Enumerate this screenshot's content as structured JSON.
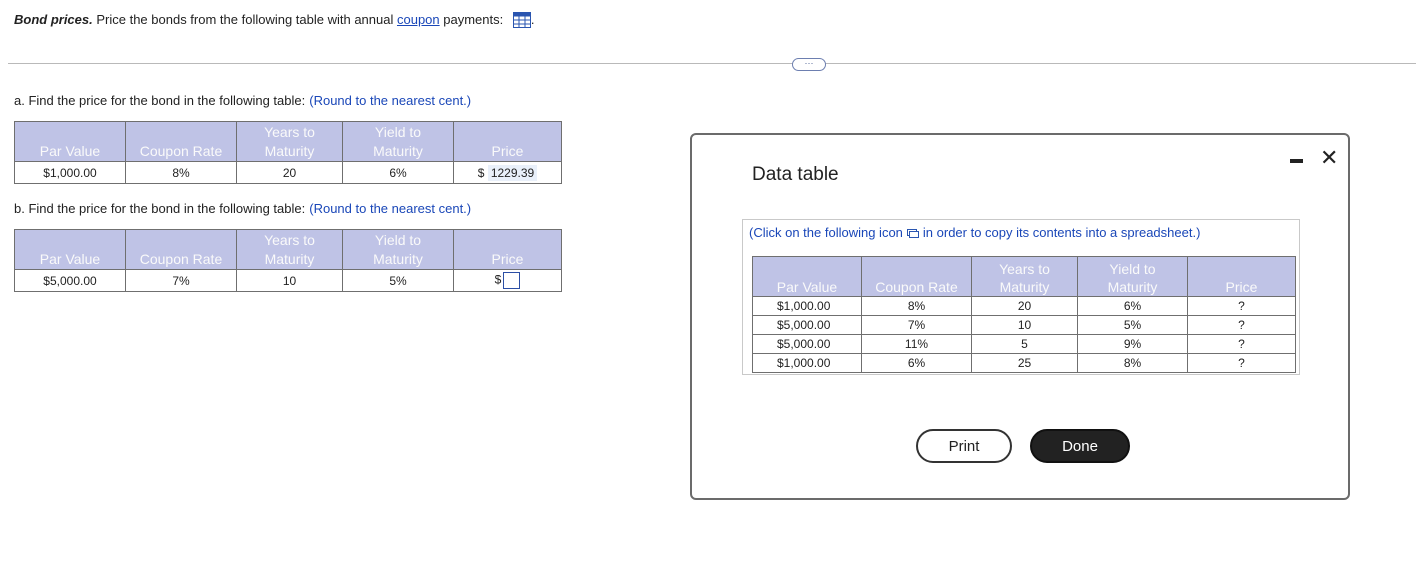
{
  "header": {
    "title": "Bond prices.",
    "text_before": " Price the bonds from the following table with annual ",
    "link": "coupon",
    "text_after": " payments:",
    "period": "."
  },
  "more_button": "···",
  "part_a": {
    "prompt": "a. Find the price for the bond in the following table:",
    "hint": "(Round to the nearest cent.)",
    "columns": [
      "Par Value",
      "Coupon Rate",
      "Years to Maturity",
      "Yield to Maturity",
      "Price"
    ],
    "columns_split": {
      "years_1": "Years to",
      "years_2": "Maturity",
      "yield_1": "Yield to",
      "yield_2": "Maturity"
    },
    "row": [
      "$1,000.00",
      "8%",
      "20",
      "6%"
    ],
    "price_prefix": "$",
    "price_answer": "1229.39"
  },
  "part_b": {
    "prompt": "b. Find the price for the bond in the following table:",
    "hint": "(Round to the nearest cent.)",
    "row": [
      "$5,000.00",
      "7%",
      "10",
      "5%"
    ],
    "price_prefix": "$",
    "price_answer": ""
  },
  "dialog": {
    "title": "Data table",
    "copy_before": "(Click on the following icon",
    "copy_after": "in order to copy its contents into a spreadsheet.)",
    "columns_split": {
      "par": "Par Value",
      "coupon": "Coupon Rate",
      "years_1": "Years to",
      "years_2": "Maturity",
      "yield_1": "Yield to",
      "yield_2": "Maturity",
      "price": "Price"
    },
    "rows": [
      [
        "$1,000.00",
        "8%",
        "20",
        "6%",
        "?"
      ],
      [
        "$5,000.00",
        "7%",
        "10",
        "5%",
        "?"
      ],
      [
        "$5,000.00",
        "11%",
        "5",
        "9%",
        "?"
      ],
      [
        "$1,000.00",
        "6%",
        "25",
        "8%",
        "?"
      ]
    ],
    "print_label": "Print",
    "done_label": "Done",
    "close_glyph": "✕"
  },
  "icons": {
    "grid": "table-grid-icon",
    "copy": "copy-spreadsheet-icon"
  },
  "colors": {
    "header_fill": "#bfc3e6",
    "link": "#1a47b8",
    "done_button": "#222222"
  }
}
